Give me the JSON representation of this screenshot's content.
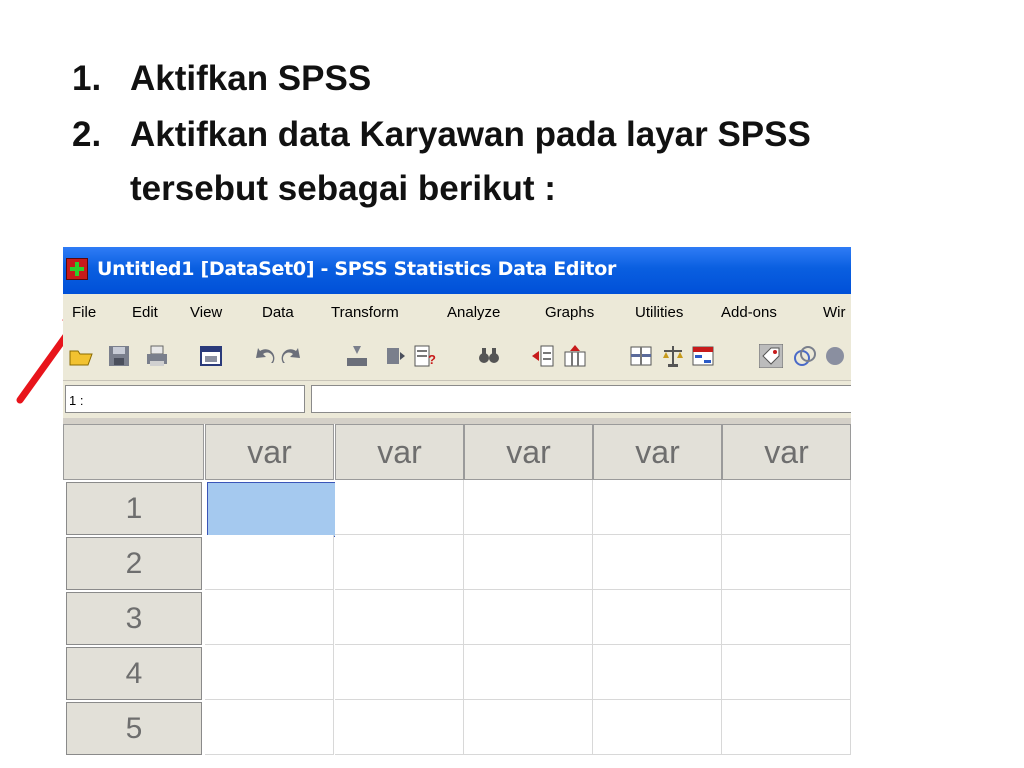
{
  "instructions": [
    {
      "num": "1.",
      "text": "Aktifkan SPSS"
    },
    {
      "num": "2.",
      "text": "Aktifkan data Karyawan pada layar SPSS"
    },
    {
      "num": "",
      "text": "tersebut sebagai berikut :"
    }
  ],
  "window": {
    "title": "Untitled1 [DataSet0] - SPSS Statistics Data Editor",
    "menu": [
      "File",
      "Edit",
      "View",
      "Data",
      "Transform",
      "Analyze",
      "Graphs",
      "Utilities",
      "Add-ons",
      "Wir"
    ],
    "toolbar_icons": [
      "open-folder-icon",
      "save-icon",
      "print-icon",
      "dialog-recall-icon",
      "undo-icon",
      "redo-icon",
      "goto-case-icon",
      "goto-variable-icon",
      "variables-icon",
      "find-icon",
      "insert-cases-icon",
      "insert-variable-icon",
      "split-file-icon",
      "weight-cases-icon",
      "select-cases-icon",
      "value-labels-icon",
      "use-sets-icon",
      "show-all-icon"
    ],
    "cell_ref": "1 :",
    "cell_value": "",
    "columns": [
      "var",
      "var",
      "var",
      "var",
      "var"
    ],
    "rows": [
      "1",
      "2",
      "3",
      "4",
      "5"
    ]
  },
  "colors": {
    "arrow": "#e8141b",
    "titlebar": "#0a5fe0",
    "selected_cell": "#a5c9ef"
  }
}
